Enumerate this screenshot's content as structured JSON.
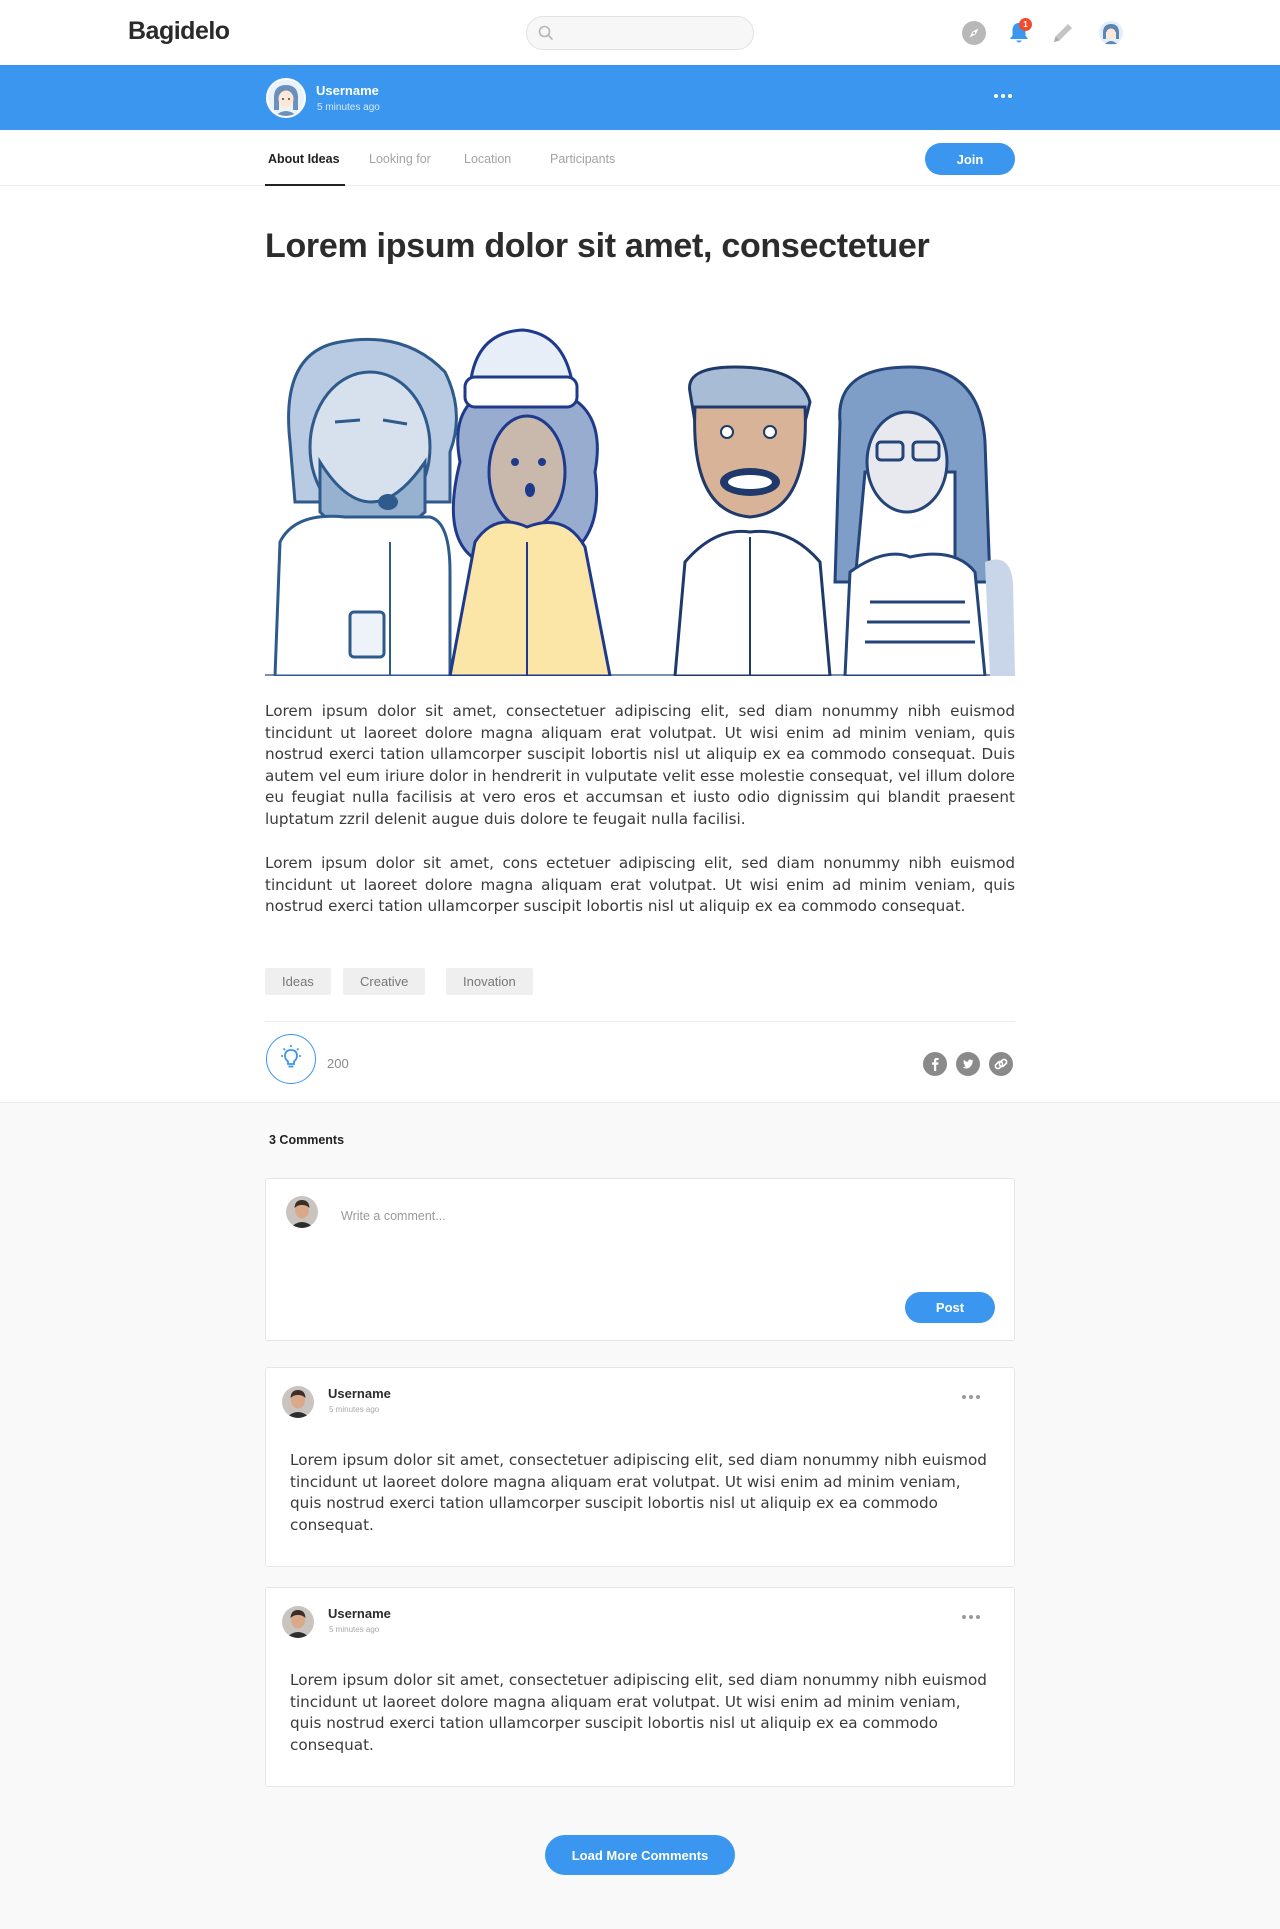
{
  "app": {
    "logo": "Bagidelo",
    "search_placeholder": "",
    "notification_count": "1",
    "accent_color": "#3a96ee"
  },
  "author_bar": {
    "username": "Username",
    "time": "5 minutes ago"
  },
  "tabs": [
    {
      "label": "About Ideas",
      "active": true
    },
    {
      "label": "Looking for",
      "active": false
    },
    {
      "label": "Location",
      "active": false
    },
    {
      "label": "Participants",
      "active": false
    }
  ],
  "join_label": "Join",
  "article": {
    "title": "Lorem ipsum dolor sit amet, consectetuer",
    "paragraphs": [
      "Lorem ipsum dolor sit amet, consectetuer adipiscing elit, sed diam nonummy nibh euismod tincidunt ut laoreet dolore magna aliquam erat volutpat. Ut wisi enim ad minim veniam, quis nostrud exerci tation ullamcorper suscipit lobortis nisl ut aliquip ex ea commodo consequat. Duis autem vel eum iriure dolor in hendrerit in vulputate velit esse molestie consequat, vel illum dolore eu feugiat nulla facilisis at vero eros et accumsan et iusto odio dignissim qui blandit praesent luptatum zzril delenit augue duis dolore te feugait nulla facilisi.",
      "Lorem ipsum dolor sit amet, cons ectetuer adipiscing elit, sed diam nonummy nibh euismod tincidunt ut laoreet dolore magna aliquam erat volutpat. Ut wisi enim ad minim veniam, quis nostrud exerci tation ullamcorper suscipit lobortis nisl ut aliquip ex ea commodo consequat."
    ],
    "tags": [
      "Ideas",
      "Creative",
      "Inovation"
    ],
    "like_count": "200"
  },
  "comments": {
    "count_label": "3 Comments",
    "compose_placeholder": "Write a comment...",
    "post_label": "Post",
    "items": [
      {
        "username": "Username",
        "time": "5 minutes ago",
        "text": "Lorem ipsum dolor sit amet, consectetuer adipiscing elit, sed diam nonummy nibh euismod tincidunt ut laoreet dolore magna aliquam erat volutpat. Ut wisi enim ad minim veniam, quis nostrud exerci tation ullamcorper suscipit lobortis nisl ut aliquip ex ea commodo consequat."
      },
      {
        "username": "Username",
        "time": "5 minutes ago",
        "text": "Lorem ipsum dolor sit amet, consectetuer adipiscing elit, sed diam nonummy nibh euismod tincidunt ut laoreet dolore magna aliquam erat volutpat. Ut wisi enim ad minim veniam, quis nostrud exerci tation ullamcorper suscipit lobortis nisl ut aliquip ex ea commodo consequat."
      }
    ],
    "load_more_label": "Load More Comments"
  },
  "icons": {
    "search": "search-icon",
    "explore": "compass-icon",
    "notifications": "bell-icon",
    "write": "pencil-icon",
    "profile": "avatar-icon",
    "more": "more-dots-icon",
    "like": "lightbulb-icon",
    "share_facebook": "facebook-icon",
    "share_twitter": "twitter-icon",
    "share_link": "link-icon"
  }
}
